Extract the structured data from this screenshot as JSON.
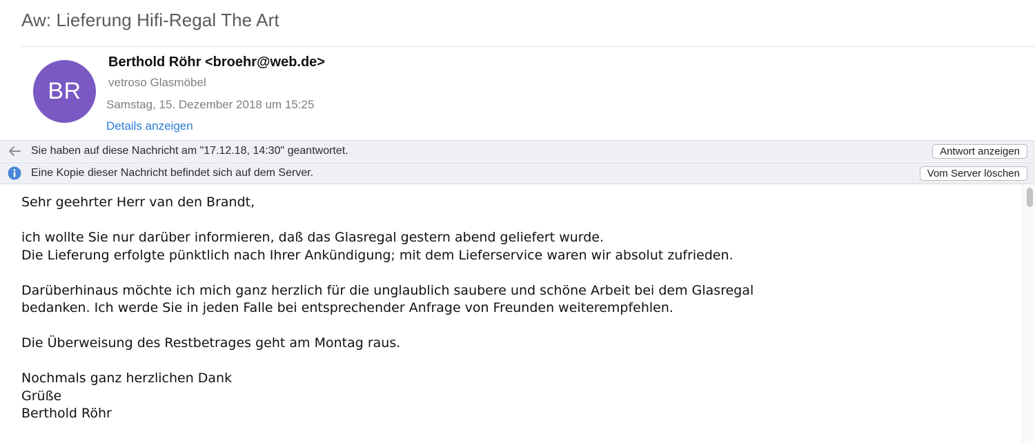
{
  "email": {
    "subject": "Aw: Lieferung Hifi-Regal The Art",
    "avatar_initials": "BR",
    "avatar_color": "#7a59c4",
    "sender": "Berthold Röhr <broehr@web.de>",
    "organization": "vetroso Glasmöbel",
    "date": "Samstag, 15. Dezember 2018 um 15:25",
    "details_link": "Details anzeigen"
  },
  "notices": {
    "replied": {
      "icon": "reply-arrow-icon",
      "text": "Sie haben auf diese Nachricht am \"17.12.18, 14:30\" geantwortet.",
      "button": "Antwort anzeigen"
    },
    "server": {
      "icon": "info-icon",
      "text": "Eine Kopie dieser Nachricht befindet sich auf dem Server.",
      "button": "Vom Server löschen"
    }
  },
  "body": {
    "greeting": "Sehr geehrter Herr van den Brandt,",
    "p1_line1": "ich wollte Sie nur darüber informieren, daß das Glasregal gestern abend geliefert wurde.",
    "p1_line2": "Die Lieferung erfolgte pünktlich nach Ihrer Ankündigung; mit dem Lieferservice waren wir absolut zufrieden.",
    "p2_line1": "Darüberhinaus möchte ich mich ganz herzlich für die unglaublich saubere und schöne Arbeit bei dem Glasregal",
    "p2_line2": "bedanken. Ich werde Sie in jeden Falle bei entsprechender Anfrage von Freunden weiterempfehlen.",
    "p3_line1": "Die Überweisung des Restbetrages geht am Montag raus.",
    "closing_line1": "Nochmals ganz herzlichen Dank",
    "closing_line2": "Grüße",
    "signature": "Berthold Röhr"
  },
  "colors": {
    "link": "#2a7ad6",
    "notice_bg": "#eef0f5",
    "info_icon": "#4a86d8"
  }
}
